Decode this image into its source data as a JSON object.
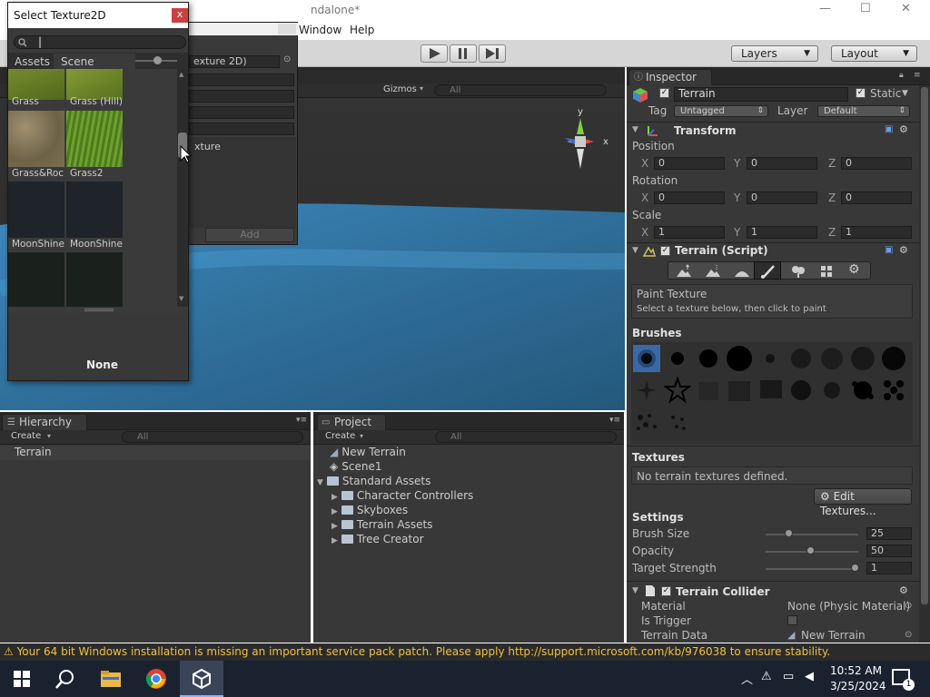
{
  "window": {
    "title_tail": "ndalone*",
    "minimize": "—",
    "maximize": "☐",
    "close": "✕"
  },
  "menu": [
    "Window",
    "Help"
  ],
  "toolbar": {
    "layers": "Layers",
    "layout": "Layout"
  },
  "picker": {
    "title": "Select Texture2D",
    "close": "x",
    "search_value": "",
    "tabs": [
      "Assets",
      "Scene"
    ],
    "items": [
      {
        "label": "Grass",
        "color": "#6b7a2a"
      },
      {
        "label": "Grass (Hill)",
        "color": "#7a8a30"
      },
      {
        "label": "Grass&Roc",
        "color": "#8a7a5a"
      },
      {
        "label": "Grass2",
        "color": "#5f8a2a"
      },
      {
        "label": "MoonShine",
        "color": "#1e2429"
      },
      {
        "label": "MoonShine",
        "color": "#1e2429"
      },
      {
        "label": "",
        "color": "#1a211d"
      },
      {
        "label": "",
        "color": "#1a211d"
      }
    ],
    "none_label": "None"
  },
  "behind_dialog": {
    "field_text": "exture 2D)",
    "label_text": "xture",
    "add_button": "Add"
  },
  "scene": {
    "gizmos": "Gizmos",
    "search_placeholder": "All",
    "axis_x": "x",
    "axis_y": "y"
  },
  "hierarchy": {
    "tab": "Hierarchy",
    "create": "Create",
    "search_placeholder": "All",
    "items": [
      "Terrain"
    ]
  },
  "project": {
    "tab": "Project",
    "create": "Create",
    "search_placeholder": "All",
    "items": [
      "New Terrain",
      "Scene1",
      "Standard Assets"
    ],
    "folders": [
      "Character Controllers",
      "Skyboxes",
      "Terrain Assets",
      "Tree Creator"
    ]
  },
  "inspector": {
    "tab": "Inspector",
    "object_name": "Terrain",
    "static_label": "Static",
    "tag_label": "Tag",
    "tag_value": "Untagged",
    "layer_label": "Layer",
    "layer_value": "Default",
    "transform": {
      "title": "Transform",
      "position_label": "Position",
      "rotation_label": "Rotation",
      "scale_label": "Scale",
      "axis": [
        "X",
        "Y",
        "Z"
      ],
      "position": [
        "0",
        "0",
        "0"
      ],
      "rotation": [
        "0",
        "0",
        "0"
      ],
      "scale": [
        "1",
        "1",
        "1"
      ]
    },
    "terrain_script": {
      "title": "Terrain (Script)",
      "paint_title": "Paint Texture",
      "paint_hint": "Select a texture below, then click to paint",
      "brushes_label": "Brushes",
      "textures_label": "Textures",
      "no_textures": "No terrain textures defined.",
      "edit_textures": "Edit Textures...",
      "settings_label": "Settings",
      "brush_size_label": "Brush Size",
      "brush_size": "25",
      "opacity_label": "Opacity",
      "opacity": "50",
      "target_strength_label": "Target Strength",
      "target_strength": "1",
      "brush_size_fraction": 0.25,
      "opacity_fraction": 0.5,
      "target_strength_fraction": 1.0
    },
    "collider": {
      "title": "Terrain Collider",
      "material_label": "Material",
      "material_value": "None (Physic Material)",
      "trigger_label": "Is Trigger",
      "data_label": "Terrain Data",
      "data_value": "New Terrain"
    }
  },
  "status": {
    "message": "⚠ Your 64 bit Windows installation is missing an important service pack patch. Please apply http://support.microsoft.com/kb/976038 to ensure stability."
  },
  "taskbar": {
    "time": "10:52 AM",
    "date": "3/25/2024",
    "notifications": "1"
  }
}
